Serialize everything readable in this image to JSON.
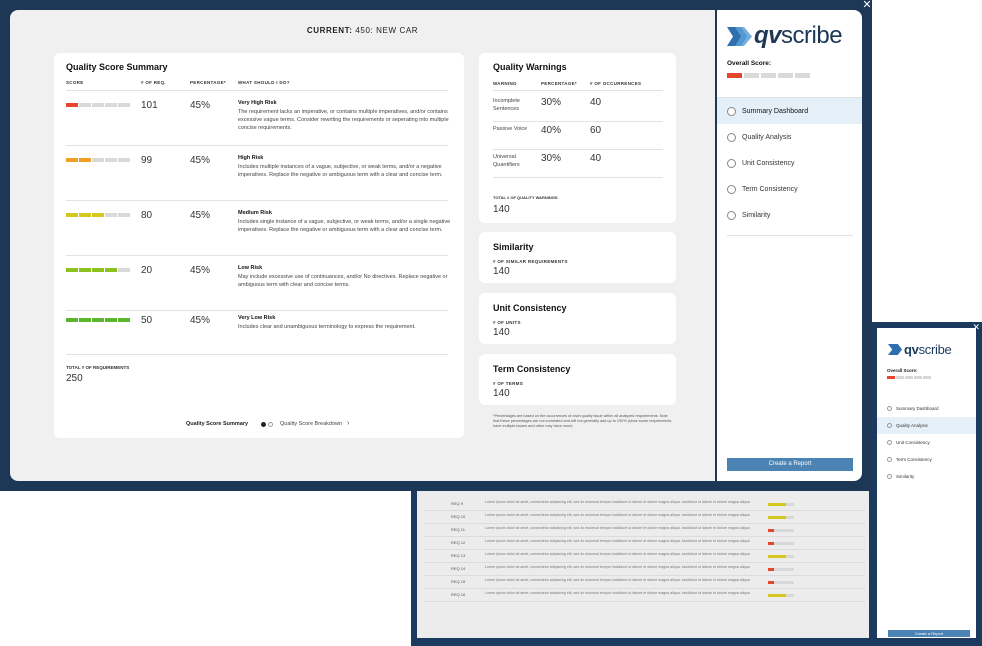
{
  "current": {
    "label": "CURRENT:",
    "value": "450: NEW CAR"
  },
  "summary": {
    "title": "Quality Score Summary",
    "columns": [
      "SCORE",
      "# OF REQ.",
      "PERCENTAGE*",
      "WHAT SHOULD I DO?"
    ],
    "rows": [
      {
        "level": 1,
        "reqs": "101",
        "pct": "45%",
        "name": "Very High Risk",
        "desc": "The requirement lacks an imperative, or contains multiple imperatives, and/or contains excessive vague terms. Consider rewriting the requirements or seperating into multiple concise requirements."
      },
      {
        "level": 2,
        "reqs": "99",
        "pct": "45%",
        "name": "High Risk",
        "desc": "Includes multiple instances of a vague, subjective, or weak terms, and/or a negative imperatives. Replace the negative or ambiguous term with a clear and concise term."
      },
      {
        "level": 3,
        "reqs": "80",
        "pct": "45%",
        "name": "Medium Risk",
        "desc": "Includes single instance of a vague, subjective, or weak terms, and/or a single negative imperatives. Replace the negative or ambiguous term with a clear and concise term."
      },
      {
        "level": 4,
        "reqs": "20",
        "pct": "45%",
        "name": "Low Risk",
        "desc": "May include excessive use of continuances, and/or No directives. Replace negative or ambiguous term with clear and concise terms."
      },
      {
        "level": 5,
        "reqs": "50",
        "pct": "45%",
        "name": "Very Low Risk",
        "desc": "Includes clear and unambiguous terminology to express the requirement."
      }
    ],
    "total_label": "TOTAL # OF REQUIREMENTS",
    "total_value": "250",
    "pager_a": "Quality Score Summary",
    "pager_b": "Quality Score Breakdown",
    "level_colors": [
      "#e8452d",
      "#f0a020",
      "#d4c81c",
      "#8cc21e",
      "#5db52a"
    ]
  },
  "warnings": {
    "title": "Quality Warnings",
    "columns": [
      "WARNING",
      "PERCENTAGE*",
      "# OF OCCURRENCES"
    ],
    "rows": [
      {
        "name": "Incomplete Sentences",
        "pct": "30%",
        "count": "40"
      },
      {
        "name": "Passive Voice",
        "pct": "40%",
        "count": "60"
      },
      {
        "name": "Universal Quantifiers",
        "pct": "30%",
        "count": "40"
      }
    ],
    "total_label": "TOTAL # OF QUALITY WARNINGS",
    "total_value": "140"
  },
  "similarity": {
    "title": "Similarity",
    "label": "# OF SIMILAR REQUIREMENTS",
    "value": "140"
  },
  "unit": {
    "title": "Unit Consistency",
    "label": "# OF UNITS",
    "value": "140"
  },
  "term": {
    "title": "Term Consistency",
    "label": "# OF TERMS",
    "value": "140"
  },
  "footnote": "*Percentages are based on the occurrences of each quality issue within all analyzed requirements. Note that these percentages are not correlated and will not generally add up to 100% (since some requirements have multiple issues and other may have none)",
  "side": {
    "logo_a": "qv",
    "logo_b": "scribe",
    "score_label": "Overall Score:",
    "score_level": 1,
    "nav": [
      "Summary Dashboard",
      "Quality Analysis",
      "Unit Consistency",
      "Term Consistency",
      "Similarity"
    ],
    "active": 0,
    "report": "Create a Report",
    "brand_color": "#2e6fb0",
    "accent": "#4b84b4"
  },
  "bg_window": {
    "score_label": "Overall Score:",
    "nav": [
      "Summary Dashboard",
      "Quality Analysis",
      "Unit Consistency",
      "Term Consistency",
      "Similarity"
    ],
    "active": 1,
    "report": "Create a Report",
    "rows": [
      {
        "id": "REQ 9",
        "bar": "#d4c81c"
      },
      {
        "id": "REQ 10",
        "bar": "#d4c81c"
      },
      {
        "id": "REQ 11",
        "bar": "#e8452d"
      },
      {
        "id": "REQ 12",
        "bar": "#e8452d"
      },
      {
        "id": "REQ 13",
        "bar": "#d4c81c"
      },
      {
        "id": "REQ 14",
        "bar": "#e8452d"
      },
      {
        "id": "REQ 15",
        "bar": "#e8452d"
      },
      {
        "id": "REQ 16",
        "bar": "#d4c81c"
      }
    ],
    "lorem": "Lorem ipsum dolor sit amet, consectetur adipiscing elit, sed do eiusmod tempor incididunt ut labore et dolore magna aliqua. incididunt ut labore et dolore magna aliqua."
  }
}
